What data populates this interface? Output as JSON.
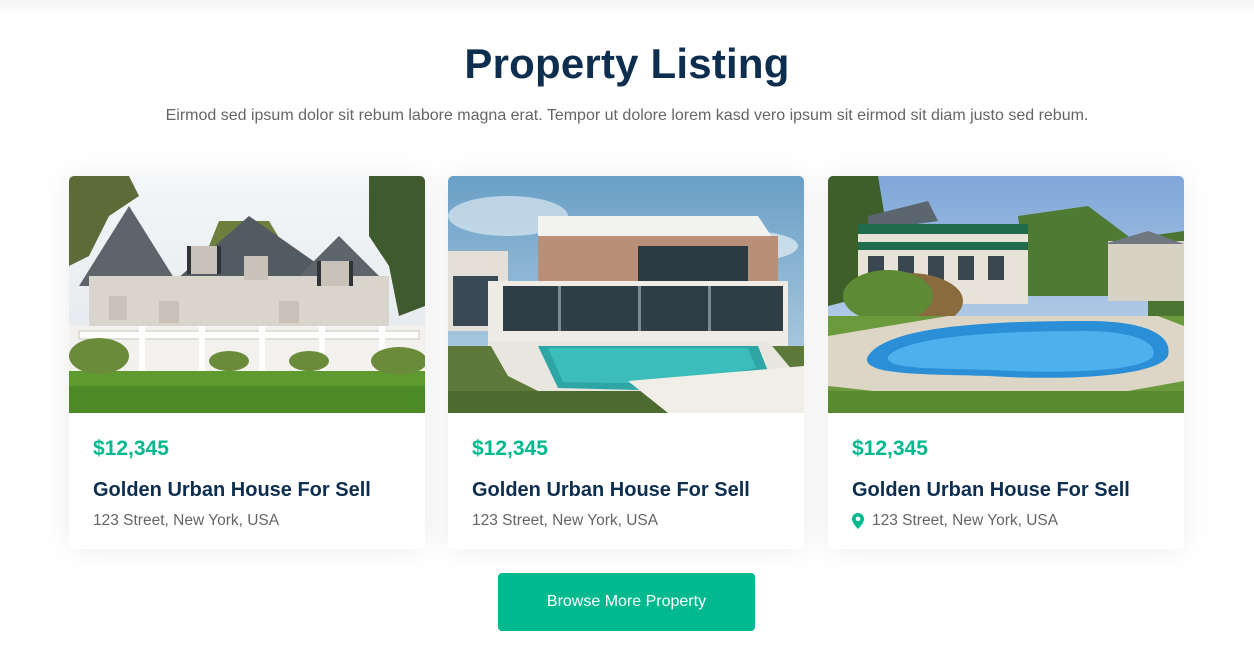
{
  "section": {
    "title": "Property Listing",
    "subtitle": "Eirmod sed ipsum dolor sit rebum labore magna erat. Tempor ut dolore lorem kasd vero ipsum sit eirmod sit diam justo sed rebum."
  },
  "listings": [
    {
      "price": "$12,345",
      "name": "Golden Urban House For Sell",
      "address": "123 Street, New York, USA",
      "image": "white-colonial-house-photo"
    },
    {
      "price": "$12,345",
      "name": "Golden Urban House For Sell",
      "address": "123 Street, New York, USA",
      "image": "modern-villa-with-pool-photo"
    },
    {
      "price": "$12,345",
      "name": "Golden Urban House For Sell",
      "address": "123 Street, New York, USA",
      "image": "house-with-backyard-pool-photo",
      "address_icon": "map-marker-icon"
    }
  ],
  "browse_button": {
    "label": "Browse More Property"
  },
  "colors": {
    "primary": "#00B98E",
    "heading": "#0E2E50",
    "body_text": "#666565"
  }
}
